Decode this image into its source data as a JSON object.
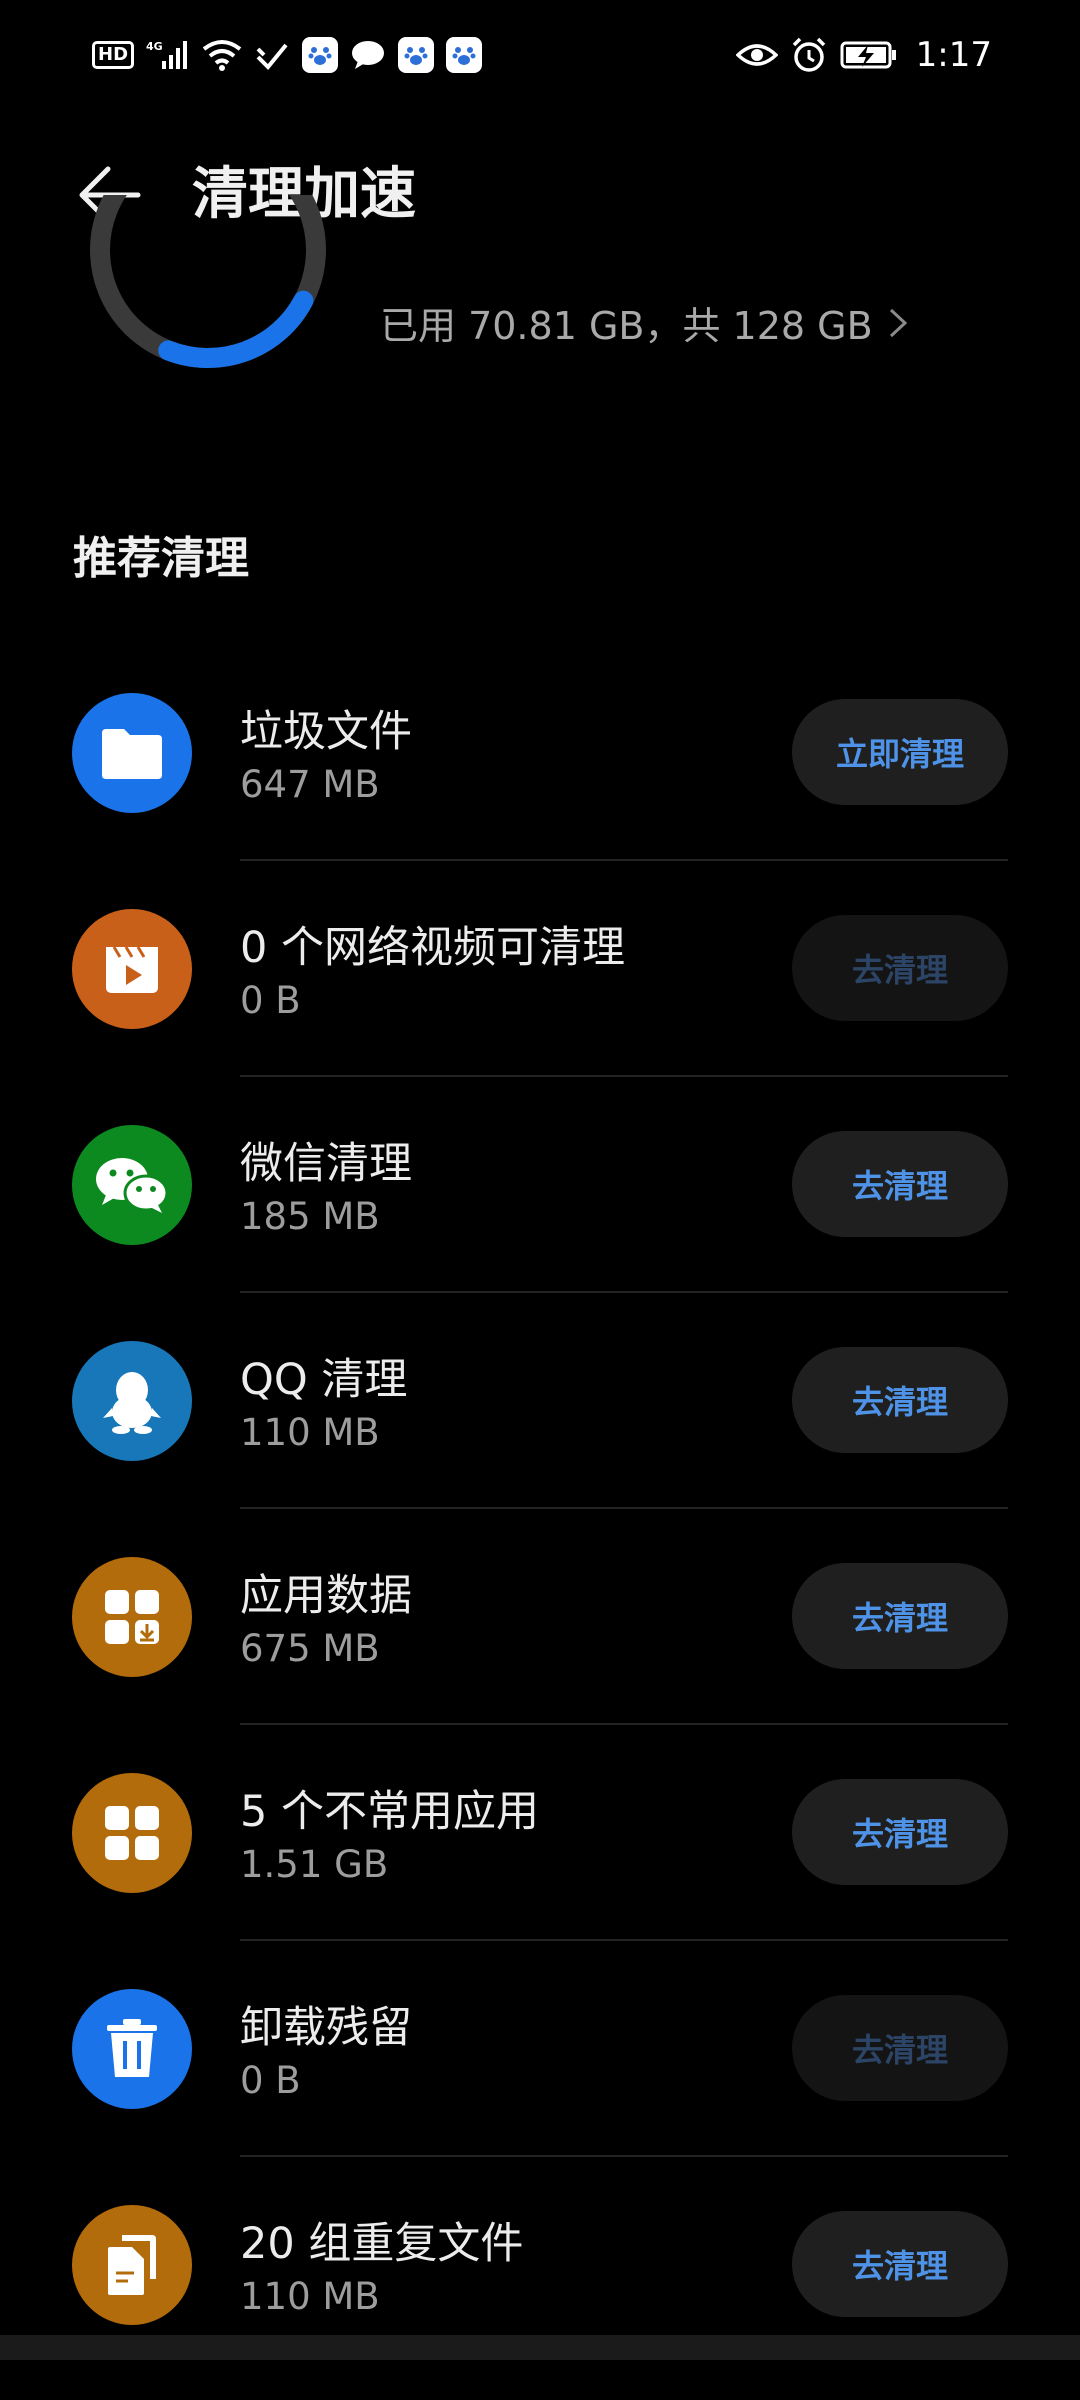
{
  "status_bar": {
    "network": "HD",
    "carrier": "4G",
    "time": "1:17"
  },
  "header": {
    "title": "清理加速"
  },
  "storage": {
    "used_text": "已用 70.81 GB，共 128 GB",
    "used_fraction": 0.553
  },
  "section": {
    "title": "推荐清理"
  },
  "items": [
    {
      "title": "垃圾文件",
      "size": "647 MB",
      "button": "立即清理",
      "enabled": true,
      "icon": "folder-icon",
      "color": "#1a73e8"
    },
    {
      "title": "0 个网络视频可清理",
      "size": "0 B",
      "button": "去清理",
      "enabled": false,
      "icon": "video-icon",
      "color": "#c9601a"
    },
    {
      "title": "微信清理",
      "size": "185 MB",
      "button": "去清理",
      "enabled": true,
      "icon": "wechat-icon",
      "color": "#0d8a1f"
    },
    {
      "title": "QQ 清理",
      "size": "110 MB",
      "button": "去清理",
      "enabled": true,
      "icon": "qq-penguin-icon",
      "color": "#1877b8"
    },
    {
      "title": "应用数据",
      "size": "675 MB",
      "button": "去清理",
      "enabled": true,
      "icon": "app-data-icon",
      "color": "#b36c0c"
    },
    {
      "title": "5 个不常用应用",
      "size": "1.51 GB",
      "button": "去清理",
      "enabled": true,
      "icon": "apps-grid-icon",
      "color": "#b36c0c"
    },
    {
      "title": "卸载残留",
      "size": "0 B",
      "button": "去清理",
      "enabled": false,
      "icon": "trash-icon",
      "color": "#1a73e8"
    },
    {
      "title": "20 组重复文件",
      "size": "110 MB",
      "button": "去清理",
      "enabled": true,
      "icon": "duplicate-files-icon",
      "color": "#b36c0c"
    }
  ]
}
